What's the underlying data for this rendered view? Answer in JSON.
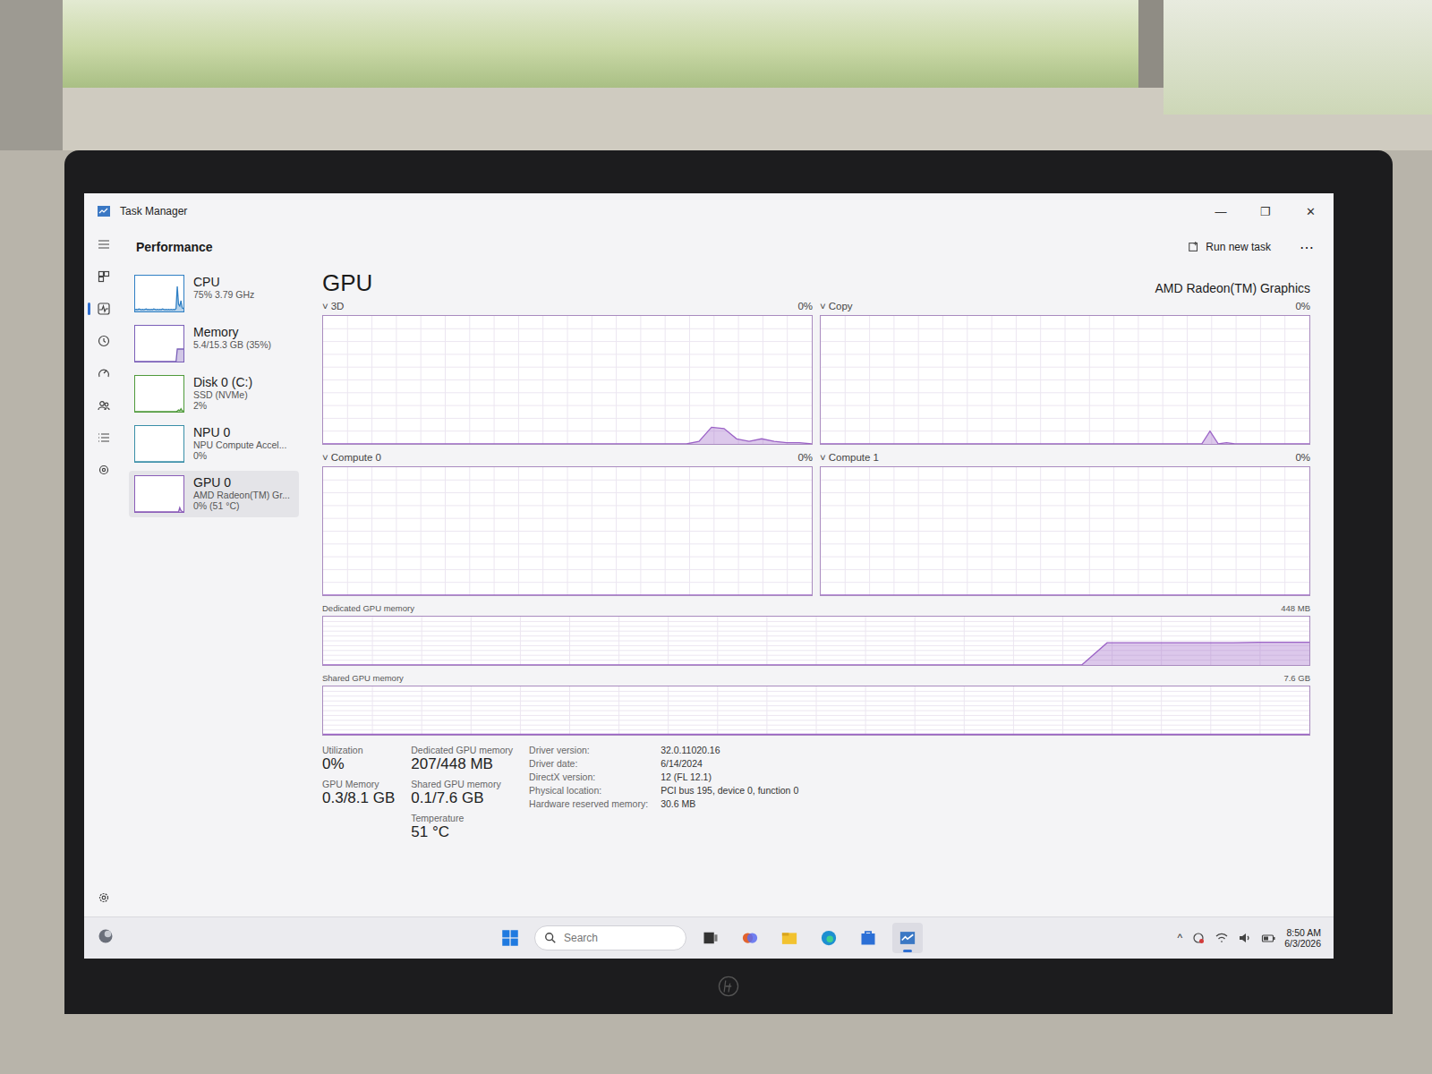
{
  "window": {
    "title": "Task Manager",
    "controls": [
      "—",
      "❐",
      "✕"
    ]
  },
  "page_header": "Performance",
  "toolbar": {
    "run_new_task": "Run new task",
    "more": "⋯"
  },
  "rail": {
    "items": [
      {
        "selected": false
      },
      {
        "selected": false
      },
      {
        "selected": true
      },
      {
        "selected": false
      },
      {
        "selected": false
      },
      {
        "selected": false
      },
      {
        "selected": false
      },
      {
        "selected": false
      }
    ],
    "settings": {
      "selected": false
    }
  },
  "sidebar": {
    "items": [
      {
        "name": "CPU",
        "details": [
          "75% 3.79 GHz"
        ],
        "selected": false,
        "color": "#2f7fc4",
        "series": [
          5,
          6,
          5,
          7,
          6,
          5,
          6,
          5,
          6,
          7,
          5,
          6,
          5,
          6,
          5,
          7,
          6,
          5,
          6,
          5,
          6,
          5,
          7,
          6,
          5,
          6,
          5,
          6,
          5,
          6,
          5,
          6,
          5,
          8,
          70,
          20,
          15,
          30,
          10,
          8
        ]
      },
      {
        "name": "Memory",
        "details": [
          "5.4/15.3 GB (35%)"
        ],
        "selected": false,
        "color": "#7a5fb8",
        "series": [
          0,
          0,
          0,
          0,
          0,
          0,
          0,
          0,
          0,
          0,
          0,
          0,
          0,
          0,
          0,
          0,
          0,
          0,
          0,
          0,
          0,
          0,
          0,
          0,
          0,
          0,
          0,
          0,
          0,
          0,
          0,
          0,
          0,
          0,
          35,
          35,
          35,
          35,
          35,
          35
        ]
      },
      {
        "name": "Disk 0 (C:)",
        "details": [
          "SSD (NVMe)",
          "2%"
        ],
        "selected": false,
        "color": "#4f9a3b",
        "series": [
          0,
          0,
          0,
          0,
          0,
          0,
          0,
          0,
          0,
          0,
          0,
          0,
          0,
          0,
          0,
          0,
          0,
          0,
          0,
          0,
          0,
          0,
          0,
          0,
          0,
          0,
          0,
          0,
          0,
          0,
          0,
          0,
          0,
          0,
          2,
          5,
          3,
          8,
          2,
          2
        ]
      },
      {
        "name": "NPU 0",
        "details": [
          "NPU Compute Accel...",
          "0%"
        ],
        "selected": false,
        "color": "#3a8fa8",
        "series": [
          0,
          0,
          0,
          0,
          0,
          0,
          0,
          0,
          0,
          0,
          0,
          0,
          0,
          0,
          0,
          0,
          0,
          0,
          0,
          0,
          0,
          0,
          0,
          0,
          0,
          0,
          0,
          0,
          0,
          0,
          0,
          0,
          0,
          0,
          0,
          0,
          0,
          0,
          0,
          0
        ]
      },
      {
        "name": "GPU 0",
        "details": [
          "AMD Radeon(TM) Gr...",
          "0% (51 °C)"
        ],
        "selected": true,
        "color": "#8a5cb8",
        "series": [
          0,
          0,
          0,
          0,
          0,
          0,
          0,
          0,
          0,
          0,
          0,
          0,
          0,
          0,
          0,
          0,
          0,
          0,
          0,
          0,
          0,
          0,
          0,
          0,
          0,
          0,
          0,
          0,
          0,
          0,
          0,
          0,
          0,
          0,
          0,
          0,
          12,
          4,
          1,
          0
        ]
      }
    ]
  },
  "gpu": {
    "title": "GPU",
    "device": "AMD Radeon(TM) Graphics",
    "engines": [
      {
        "toggle": "˅",
        "label": "3D",
        "percent": "0%",
        "values": [
          0,
          0,
          0,
          0,
          0,
          0,
          0,
          0,
          0,
          0,
          0,
          0,
          0,
          0,
          0,
          0,
          0,
          0,
          0,
          0,
          0,
          0,
          0,
          0,
          0,
          0,
          0,
          0,
          0,
          0,
          2,
          13,
          12,
          4,
          2,
          4,
          2,
          1,
          1,
          0
        ]
      },
      {
        "toggle": "˅",
        "label": "Copy",
        "percent": "0%",
        "values": [
          0,
          0,
          0,
          0,
          0,
          0,
          0,
          0,
          0,
          0,
          0,
          0,
          0,
          0,
          0,
          0,
          0,
          0,
          0,
          0,
          0,
          0,
          0,
          0,
          0,
          0,
          0,
          0,
          0,
          0,
          0,
          0,
          0,
          0,
          0,
          0,
          0,
          0,
          0,
          0,
          0,
          0,
          0,
          0,
          0,
          0,
          0,
          10,
          0,
          1,
          0,
          0,
          0,
          0,
          0,
          0,
          0,
          0,
          0,
          0
        ]
      },
      {
        "toggle": "˅",
        "label": "Compute 0",
        "percent": "0%",
        "values": [
          0,
          0,
          0,
          0,
          0,
          0,
          0,
          0,
          0,
          0,
          0,
          0,
          0,
          0,
          0,
          0,
          0,
          0,
          0,
          0,
          0,
          0,
          0,
          0,
          0,
          0,
          0,
          0,
          0,
          0,
          0,
          0,
          0,
          0,
          0,
          0,
          0,
          0,
          0,
          0
        ]
      },
      {
        "toggle": "˅",
        "label": "Compute 1",
        "percent": "0%",
        "values": [
          0,
          0,
          0,
          0,
          0,
          0,
          0,
          0,
          0,
          0,
          0,
          0,
          0,
          0,
          0,
          0,
          0,
          0,
          0,
          0,
          0,
          0,
          0,
          0,
          0,
          0,
          0,
          0,
          0,
          0,
          0,
          0,
          0,
          0,
          0,
          0,
          0,
          0,
          0,
          0
        ]
      }
    ],
    "memory_charts": [
      {
        "label": "Dedicated GPU memory",
        "max": "448 MB",
        "values": [
          0,
          0,
          0,
          0,
          0,
          0,
          0,
          0,
          0,
          0,
          0,
          0,
          0,
          0,
          0,
          0,
          0,
          0,
          0,
          0,
          0,
          0,
          0,
          0,
          0,
          0,
          0,
          0,
          0,
          0,
          0,
          46,
          46,
          46,
          46,
          46,
          46,
          47,
          47,
          47
        ]
      },
      {
        "label": "Shared GPU memory",
        "max": "7.6 GB",
        "values": [
          1,
          1,
          1,
          1,
          1,
          1,
          1,
          1,
          1,
          1,
          1,
          1,
          1,
          1,
          1,
          1,
          1,
          1,
          1,
          1,
          1,
          1,
          1,
          1,
          1,
          1,
          1,
          1,
          1,
          1,
          1,
          1,
          1,
          1,
          1,
          1,
          1,
          1,
          1,
          1
        ]
      }
    ],
    "stats": [
      [
        {
          "label": "Utilization",
          "value": "0%"
        },
        {
          "label": "GPU Memory",
          "value": "0.3/8.1 GB"
        }
      ],
      [
        {
          "label": "Dedicated GPU memory",
          "value": "207/448 MB"
        },
        {
          "label": "Shared GPU memory",
          "value": "0.1/7.6 GB"
        },
        {
          "label": "Temperature",
          "value": "51 °C"
        }
      ]
    ],
    "details": [
      {
        "key": "Driver version:",
        "value": "32.0.11020.16"
      },
      {
        "key": "Driver date:",
        "value": "6/14/2024"
      },
      {
        "key": "DirectX version:",
        "value": "12 (FL 12.1)"
      },
      {
        "key": "Physical location:",
        "value": "PCI bus 195, device 0, function 0"
      },
      {
        "key": "Hardware reserved memory:",
        "value": "30.6 MB"
      }
    ]
  },
  "taskbar": {
    "search": {
      "placeholder": "Search"
    },
    "apps": [
      {
        "selected": false
      },
      {
        "selected": false
      },
      {
        "selected": false
      },
      {
        "selected": false
      },
      {
        "selected": false
      },
      {
        "selected": true
      }
    ],
    "tray_chevron": "^",
    "time": "8:50 AM",
    "date": "6/3/2026"
  }
}
